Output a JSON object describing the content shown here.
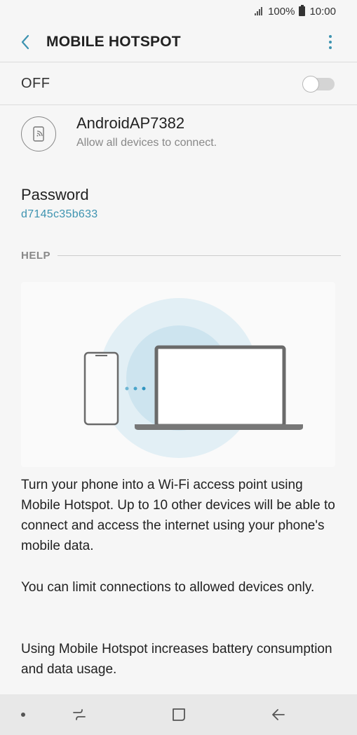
{
  "status_bar": {
    "battery_text": "100%",
    "time": "10:00",
    "icons": [
      "signal-icon",
      "battery-icon"
    ]
  },
  "app_bar": {
    "title": "MOBILE HOTSPOT",
    "back_icon": "back-arrow-icon",
    "more_icon": "more-vert-icon"
  },
  "hotspot_switch": {
    "label": "OFF",
    "enabled": false
  },
  "network": {
    "name": "AndroidAP7382",
    "subtitle": "Allow all devices to connect.",
    "icon": "hotspot-device-icon"
  },
  "password": {
    "label": "Password",
    "value": "d7145c35b633"
  },
  "help": {
    "header": "HELP",
    "illustration": "phone-to-laptop-illustration",
    "paragraphs": [
      "Turn your phone into a Wi-Fi access point using Mobile Hotspot. Up to 10 other devices will be able to connect and access the internet using your phone's mobile data.",
      "You can limit connections to allowed devices only.",
      "Using Mobile Hotspot increases battery consumption and data usage."
    ]
  },
  "nav_bar": {
    "icons": [
      "recents-icon",
      "home-icon",
      "back-icon"
    ]
  },
  "colors": {
    "accent": "#3d93b0",
    "background": "#f6f6f6",
    "nav_bar": "#e8e8e8"
  }
}
